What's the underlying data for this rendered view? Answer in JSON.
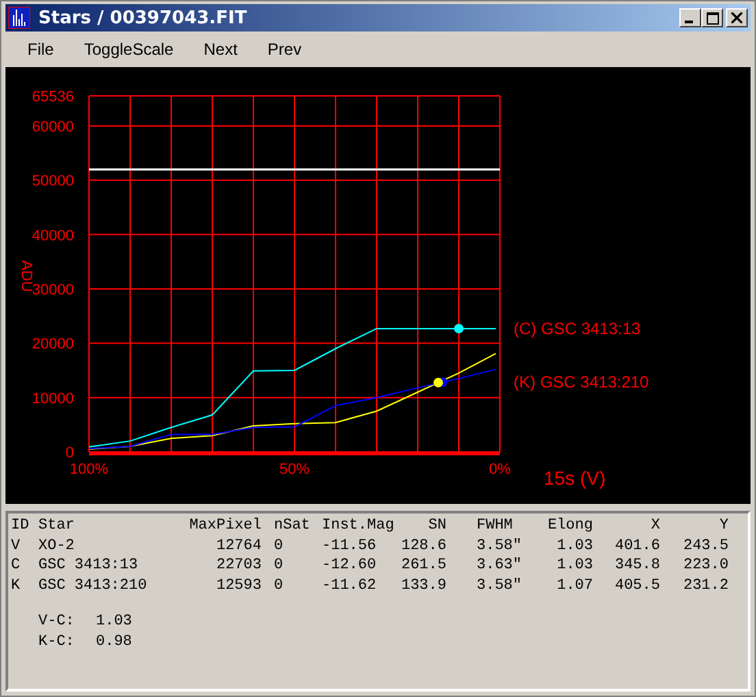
{
  "window": {
    "title": "Stars / 00397043.FIT"
  },
  "menu": [
    "File",
    "ToggleScale",
    "Next",
    "Prev"
  ],
  "plot": {
    "chart_data": {
      "type": "line",
      "grid": true,
      "xlabel": "15s (V)",
      "ylabel": "ADU",
      "x": [
        100,
        90,
        80,
        70,
        60,
        50,
        40,
        30,
        20,
        10,
        1
      ],
      "xlim": [
        100,
        0
      ],
      "ylim": [
        0,
        65536
      ],
      "xticks": [
        {
          "value": 100,
          "label": "100%"
        },
        {
          "value": 50,
          "label": "50%"
        },
        {
          "value": 0,
          "label": "0%"
        }
      ],
      "yticks": [
        0,
        10000,
        20000,
        30000,
        40000,
        50000,
        60000,
        65536
      ],
      "series": [
        {
          "color": "#ffff00",
          "values": [
            500,
            1000,
            2500,
            3000,
            4800,
            5200,
            5400,
            7500,
            11000,
            14500,
            18100
          ]
        },
        {
          "name": "(C) GSC 3413:13",
          "color": "#00ffff",
          "values": [
            900,
            2000,
            4500,
            6800,
            14900,
            15000,
            19000,
            22700,
            22700,
            22700,
            22700
          ]
        },
        {
          "name": "(K) GSC 3413:210",
          "color": "#0000ff",
          "values": [
            600,
            1000,
            3200,
            3200,
            4500,
            4600,
            8500,
            10000,
            11800,
            13500,
            15200
          ]
        }
      ],
      "ref_lines": [
        {
          "axis": "y",
          "value": 52000
        }
      ]
    }
  },
  "table": {
    "columns": [
      "ID",
      "Star",
      "MaxPixel",
      "nSat",
      "Inst.Mag",
      "SN",
      "FWHM",
      "Elong",
      "X",
      "Y"
    ],
    "rows": [
      [
        "V",
        "XO-2",
        "12764",
        "0",
        "-11.56",
        "128.6",
        "3.58\"",
        "1.03",
        "401.6",
        "243.5"
      ],
      [
        "C",
        "GSC 3413:13",
        "22703",
        "0",
        "-12.60",
        "261.5",
        "3.63\"",
        "1.03",
        "345.8",
        "223.0"
      ],
      [
        "K",
        "GSC 3413:210",
        "12593",
        "0",
        "-11.62",
        "133.9",
        "3.58\"",
        "1.07",
        "405.5",
        "231.2"
      ]
    ]
  },
  "differences": [
    {
      "label": "V-C:",
      "value": "1.03"
    },
    {
      "label": "K-C:",
      "value": "0.98"
    }
  ]
}
